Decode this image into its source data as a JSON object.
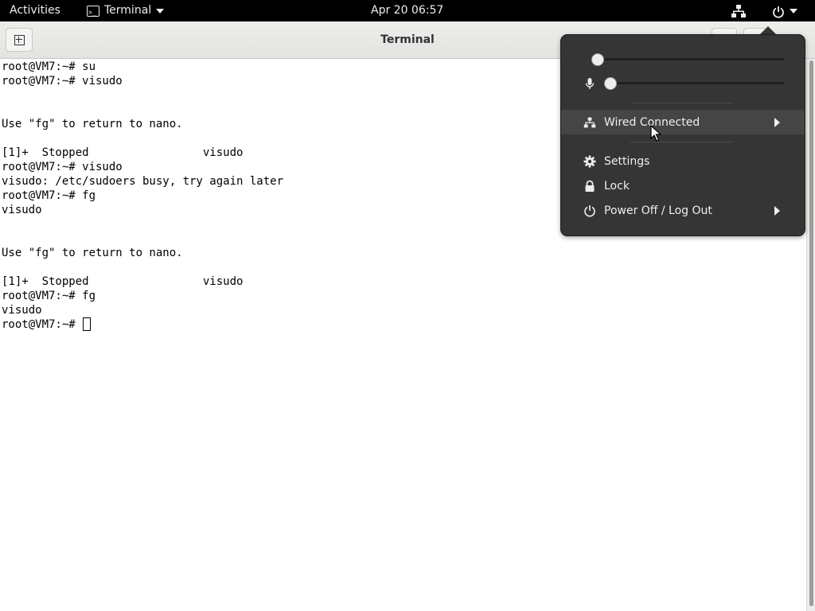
{
  "topbar": {
    "activities": "Activities",
    "app_menu": "Terminal",
    "clock": "Apr 20  06:57"
  },
  "window": {
    "title": "Terminal"
  },
  "terminal": {
    "lines": [
      "root@VM7:~# su",
      "root@VM7:~# visudo",
      "",
      "",
      "Use \"fg\" to return to nano.",
      "",
      "[1]+  Stopped                 visudo",
      "root@VM7:~# visudo",
      "visudo: /etc/sudoers busy, try again later",
      "root@VM7:~# fg",
      "visudo",
      "",
      "",
      "Use \"fg\" to return to nano.",
      "",
      "[1]+  Stopped                 visudo",
      "root@VM7:~# fg",
      "visudo"
    ],
    "prompt": "root@VM7:~# "
  },
  "system_menu": {
    "volume_level": 0.0,
    "mic_level": 0.0,
    "items": {
      "wired": "Wired Connected",
      "settings": "Settings",
      "lock": "Lock",
      "power": "Power Off / Log Out"
    }
  },
  "icons": {
    "network": "network-wired-icon",
    "power": "power-icon",
    "volume": "volume-icon",
    "microphone": "microphone-icon",
    "settings": "gear-icon",
    "lock": "lock-icon"
  }
}
